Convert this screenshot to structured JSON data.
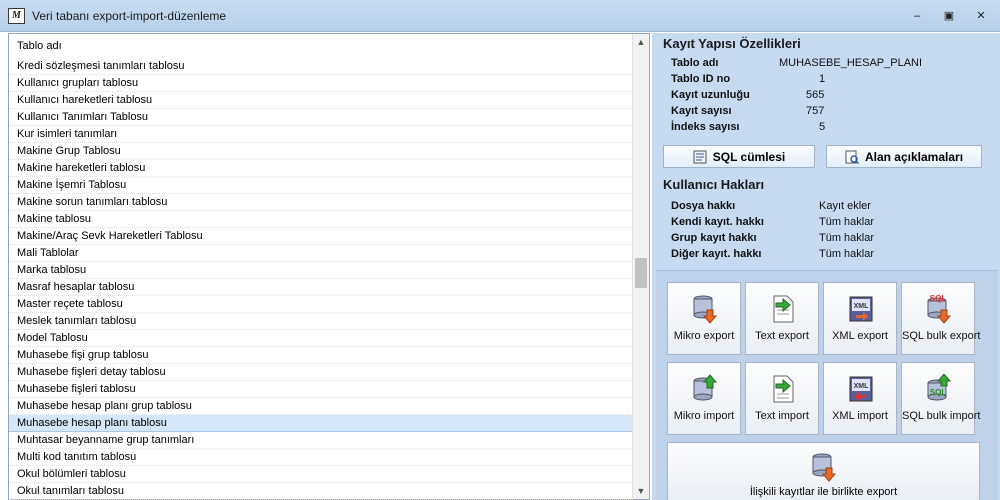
{
  "window": {
    "title": "Veri tabanı export-import-düzenleme",
    "minimize_glyph": "–",
    "restore_glyph": "▣",
    "close_glyph": "✕"
  },
  "table_list": {
    "header": "Tablo adı",
    "rows": [
      "Kredi sözleşmesi tanımları tablosu",
      "Kullanıcı grupları tablosu",
      "Kullanıcı hareketleri tablosu",
      "Kullanıcı Tanımları Tablosu",
      "Kur isimleri tanımları",
      "Makine Grup Tablosu",
      "Makine hareketleri tablosu",
      "Makine İşemri Tablosu",
      "Makine sorun tanımları tablosu",
      "Makine tablosu",
      "Makine/Araç Sevk Hareketleri Tablosu",
      "Mali Tablolar",
      "Marka tablosu",
      "Masraf hesaplar tablosu",
      "Master reçete tablosu",
      "Meslek tanımları tablosu",
      "Model Tablosu",
      "Muhasebe fişi grup tablosu",
      "Muhasebe fişleri detay tablosu",
      "Muhasebe fişleri tablosu",
      "Muhasebe hesap planı grup tablosu",
      "Muhasebe hesap planı tablosu",
      "Muhtasar beyanname grup tanımları",
      "Multi kod tanıtım tablosu",
      "Okul bölümleri tablosu",
      "Okul tanımları tablosu"
    ],
    "selected_row": "Muhasebe hesap planı tablosu"
  },
  "record_structure": {
    "title": "Kayıt Yapısı Özellikleri",
    "items": [
      {
        "label": "Tablo adı",
        "value": "MUHASEBE_HESAP_PLANI"
      },
      {
        "label": "Tablo ID no",
        "value": "1"
      },
      {
        "label": "Kayıt uzunluğu",
        "value": "565"
      },
      {
        "label": "Kayıt sayısı",
        "value": "757"
      },
      {
        "label": "İndeks sayısı",
        "value": "5"
      }
    ]
  },
  "buttons": {
    "sql_statement": "SQL cümlesi",
    "field_descriptions": "Alan açıklamaları"
  },
  "user_rights": {
    "title": "Kullanıcı Hakları",
    "items": [
      {
        "label": "Dosya hakkı",
        "value": "Kayıt ekler"
      },
      {
        "label": "Kendi kayıt. hakkı",
        "value": "Tüm haklar"
      },
      {
        "label": "Grup kayıt hakkı",
        "value": "Tüm haklar"
      },
      {
        "label": "Diğer kayıt. hakkı",
        "value": "Tüm haklar"
      }
    ]
  },
  "export_import": {
    "tiles": [
      {
        "label": "Mikro export",
        "icon": "database-export-icon"
      },
      {
        "label": "Text export",
        "icon": "text-export-icon"
      },
      {
        "label": "XML export",
        "icon": "xml-export-icon"
      },
      {
        "label": "SQL bulk export",
        "icon": "sql-export-icon"
      },
      {
        "label": "Mikro import",
        "icon": "database-import-icon"
      },
      {
        "label": "Text import",
        "icon": "text-import-icon"
      },
      {
        "label": "XML import",
        "icon": "xml-import-icon"
      },
      {
        "label": "SQL bulk import",
        "icon": "sql-import-icon"
      }
    ],
    "related_export_label": "İlişkili kayıtlar ile birlikte export"
  },
  "colors": {
    "panel_bg": "#c7daf0",
    "selected_row": "#d4e6f7",
    "export_arrow": "#e8672a",
    "import_arrow": "#3aa53a"
  }
}
